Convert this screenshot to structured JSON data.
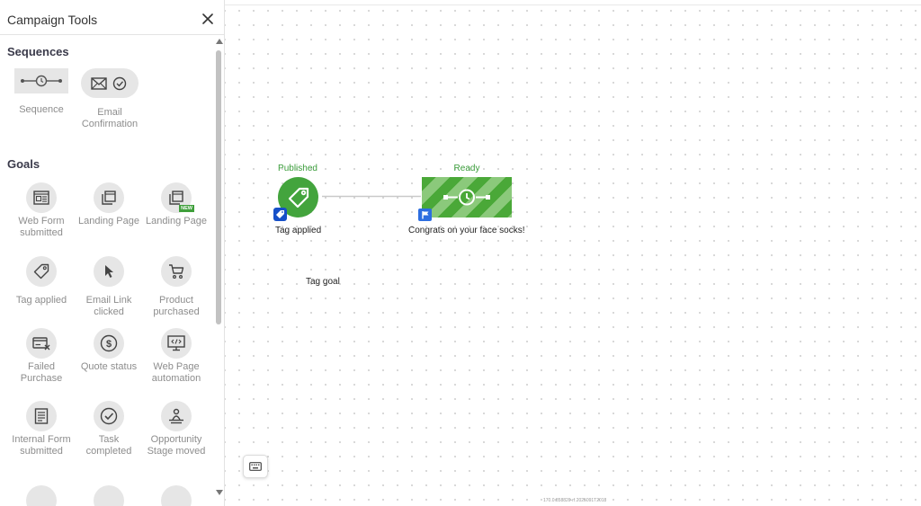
{
  "sidebar": {
    "title": "Campaign Tools",
    "sections": {
      "sequences": {
        "title": "Sequences",
        "items": [
          {
            "label": "Sequence",
            "icon": "sequence-timer-icon"
          },
          {
            "label": "Email Confirmation",
            "icon": "email-confirmation-icon"
          }
        ]
      },
      "goals": {
        "title": "Goals",
        "items": [
          {
            "label": "Web Form submitted",
            "icon": "web-form-icon"
          },
          {
            "label": "Landing Page",
            "icon": "landing-page-icon"
          },
          {
            "label": "Landing Page",
            "icon": "landing-page-new-icon",
            "badge": "NEW"
          },
          {
            "label": "Tag applied",
            "icon": "tag-icon"
          },
          {
            "label": "Email Link clicked",
            "icon": "cursor-icon"
          },
          {
            "label": "Product purchased",
            "icon": "cart-icon"
          },
          {
            "label": "Failed Purchase",
            "icon": "failed-purchase-icon"
          },
          {
            "label": "Quote status",
            "icon": "dollar-icon"
          },
          {
            "label": "Web Page automation",
            "icon": "web-code-icon"
          },
          {
            "label": "Internal Form submitted",
            "icon": "document-icon"
          },
          {
            "label": "Task completed",
            "icon": "check-circle-icon"
          },
          {
            "label": "Opportunity Stage moved",
            "icon": "stage-icon"
          }
        ]
      }
    }
  },
  "canvas": {
    "goal_node": {
      "status": "Published",
      "caption": "Tag applied",
      "label": "Tag goal",
      "color": "#43a43d"
    },
    "sequence_node": {
      "status": "Ready",
      "caption": "Congrats on your face socks!",
      "color": "#4aa838"
    },
    "version": "170.0.858820-rf.2025091T2018"
  },
  "colors": {
    "accent_green": "#43a43d",
    "status_green": "#3a9c3a",
    "badge_blue": "#1650c8"
  }
}
